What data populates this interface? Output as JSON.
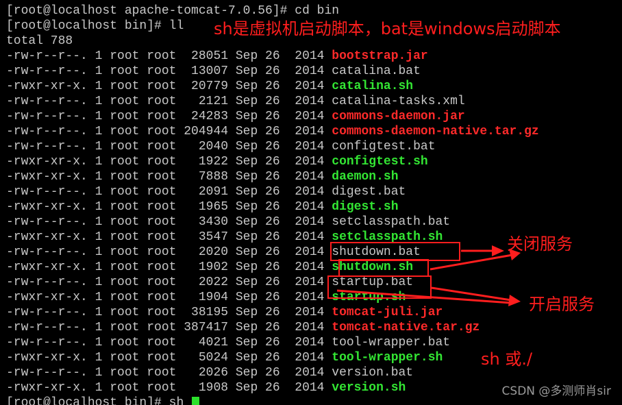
{
  "terminal": {
    "header_lines": [
      "[root@localhost apache-tomcat-7.0.56]# cd bin",
      "[root@localhost bin]# ll",
      "total 788"
    ],
    "files": [
      {
        "meta": "-rw-r--r--. 1 root root  28051 Sep 26  2014 ",
        "name": "bootstrap.jar",
        "kind": "jar"
      },
      {
        "meta": "-rw-r--r--. 1 root root  13007 Sep 26  2014 ",
        "name": "catalina.bat",
        "kind": "bat"
      },
      {
        "meta": "-rwxr-xr-x. 1 root root  20779 Sep 26  2014 ",
        "name": "catalina.sh",
        "kind": "sh"
      },
      {
        "meta": "-rw-r--r--. 1 root root   2121 Sep 26  2014 ",
        "name": "catalina-tasks.xml",
        "kind": "xml"
      },
      {
        "meta": "-rw-r--r--. 1 root root  24283 Sep 26  2014 ",
        "name": "commons-daemon.jar",
        "kind": "jar"
      },
      {
        "meta": "-rw-r--r--. 1 root root 204944 Sep 26  2014 ",
        "name": "commons-daemon-native.tar.gz",
        "kind": "gz"
      },
      {
        "meta": "-rw-r--r--. 1 root root   2040 Sep 26  2014 ",
        "name": "configtest.bat",
        "kind": "bat"
      },
      {
        "meta": "-rwxr-xr-x. 1 root root   1922 Sep 26  2014 ",
        "name": "configtest.sh",
        "kind": "sh"
      },
      {
        "meta": "-rwxr-xr-x. 1 root root   7888 Sep 26  2014 ",
        "name": "daemon.sh",
        "kind": "sh"
      },
      {
        "meta": "-rw-r--r--. 1 root root   2091 Sep 26  2014 ",
        "name": "digest.bat",
        "kind": "bat"
      },
      {
        "meta": "-rwxr-xr-x. 1 root root   1965 Sep 26  2014 ",
        "name": "digest.sh",
        "kind": "sh"
      },
      {
        "meta": "-rw-r--r--. 1 root root   3430 Sep 26  2014 ",
        "name": "setclasspath.bat",
        "kind": "bat"
      },
      {
        "meta": "-rwxr-xr-x. 1 root root   3547 Sep 26  2014 ",
        "name": "setclasspath.sh",
        "kind": "sh"
      },
      {
        "meta": "-rw-r--r--. 1 root root   2020 Sep 26  2014 ",
        "name": "shutdown.bat",
        "kind": "bat"
      },
      {
        "meta": "-rwxr-xr-x. 1 root root   1902 Sep 26  2014 ",
        "name": "shutdown.sh",
        "kind": "sh"
      },
      {
        "meta": "-rw-r--r--. 1 root root   2022 Sep 26  2014 ",
        "name": "startup.bat",
        "kind": "bat"
      },
      {
        "meta": "-rwxr-xr-x. 1 root root   1904 Sep 26  2014 ",
        "name": "startup.sh",
        "kind": "sh"
      },
      {
        "meta": "-rw-r--r--. 1 root root  38195 Sep 26  2014 ",
        "name": "tomcat-juli.jar",
        "kind": "jar"
      },
      {
        "meta": "-rw-r--r--. 1 root root 387417 Sep 26  2014 ",
        "name": "tomcat-native.tar.gz",
        "kind": "gz"
      },
      {
        "meta": "-rw-r--r--. 1 root root   4021 Sep 26  2014 ",
        "name": "tool-wrapper.bat",
        "kind": "bat"
      },
      {
        "meta": "-rwxr-xr-x. 1 root root   5024 Sep 26  2014 ",
        "name": "tool-wrapper.sh",
        "kind": "sh"
      },
      {
        "meta": "-rw-r--r--. 1 root root   2026 Sep 26  2014 ",
        "name": "version.bat",
        "kind": "bat"
      },
      {
        "meta": "-rwxr-xr-x. 1 root root   1908 Sep 26  2014 ",
        "name": "version.sh",
        "kind": "sh"
      }
    ],
    "prompt_line": "[root@localhost bin]# sh "
  },
  "annotations": {
    "main_note": "sh是虚拟机启动脚本，bat是windows启动脚本",
    "stop_service": "关闭服务",
    "start_service": "开启服务",
    "run_hint": "sh   或./"
  },
  "watermark": "CSDN @多测师肖sir",
  "colors": {
    "background": "#000000",
    "text": "#c8c8c8",
    "executable": "#33e633",
    "archive": "#ff2a2a",
    "annotation": "#ff1e1e",
    "cursor": "#2be02b"
  }
}
